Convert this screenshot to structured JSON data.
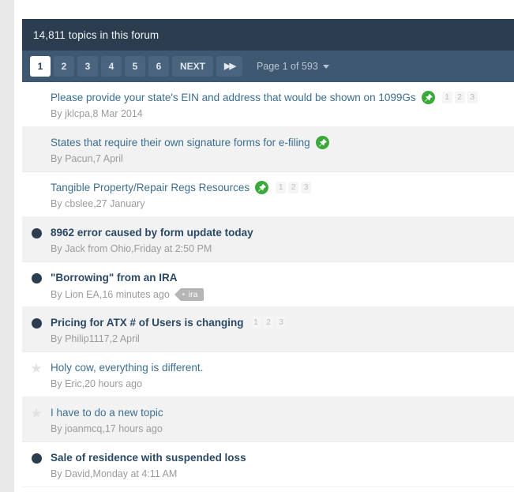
{
  "header": {
    "topic_count_label": "14,811 topics in this forum"
  },
  "pagination": {
    "pages": [
      "1",
      "2",
      "3",
      "4",
      "5",
      "6"
    ],
    "active_page": "1",
    "next_label": "NEXT",
    "last_label": "▶▶",
    "page_jump_label": "Page 1 of 593"
  },
  "colors": {
    "header_bg": "#2b3d4f",
    "pagination_bg": "#3f5871",
    "pin_green": "#3aa93a",
    "link_blue": "#3b6e8f",
    "unread_dot": "#2b3d4f",
    "row_alt_bg": "#f2f2f2",
    "tag_gray": "#b5b5b5"
  },
  "topics": [
    {
      "title": "Please provide your state's EIN and address that would be shown on 1099Gs",
      "status": "none",
      "pinned": true,
      "unread": false,
      "mini_pages": [
        "1",
        "2",
        "3"
      ],
      "by_prefix": "By",
      "author": "jklcpa",
      "date": "8 Mar 2014",
      "tag": null
    },
    {
      "title": "States that require their own signature forms for e-filing",
      "status": "none",
      "pinned": true,
      "unread": false,
      "mini_pages": [],
      "by_prefix": "By",
      "author": "Pacun",
      "date": "7 April",
      "tag": null
    },
    {
      "title": "Tangible Property/Repair Regs Resources",
      "status": "none",
      "pinned": true,
      "unread": false,
      "mini_pages": [
        "1",
        "2",
        "3"
      ],
      "by_prefix": "By",
      "author": "cbslee",
      "date": "27 January",
      "tag": null
    },
    {
      "title": "8962 error caused by form update today",
      "status": "unread",
      "pinned": false,
      "unread": true,
      "mini_pages": [],
      "by_prefix": "By",
      "author": "Jack from Ohio",
      "date": "Friday at 2:50 PM",
      "tag": null
    },
    {
      "title": "\"Borrowing\" from an IRA",
      "status": "unread",
      "pinned": false,
      "unread": true,
      "mini_pages": [],
      "by_prefix": "By",
      "author": "Lion EA",
      "date": "16 minutes ago",
      "tag": "ira"
    },
    {
      "title": "Pricing for ATX # of Users is changing",
      "status": "unread",
      "pinned": false,
      "unread": true,
      "mini_pages": [
        "1",
        "2",
        "3"
      ],
      "by_prefix": "By",
      "author": "Philip1117",
      "date": "2 April",
      "tag": null
    },
    {
      "title": "Holy cow, everything is different.",
      "status": "read",
      "pinned": false,
      "unread": false,
      "mini_pages": [],
      "by_prefix": "By",
      "author": "Eric",
      "date": "20 hours ago",
      "tag": null
    },
    {
      "title": "I have to do a new topic",
      "status": "read",
      "pinned": false,
      "unread": false,
      "mini_pages": [],
      "by_prefix": "By",
      "author": "joanmcq",
      "date": "17 hours ago",
      "tag": null
    },
    {
      "title": "Sale of residence with suspended loss",
      "status": "unread",
      "pinned": false,
      "unread": true,
      "mini_pages": [],
      "by_prefix": "By",
      "author": "David",
      "date": "Monday at 4:11 AM",
      "tag": null
    }
  ]
}
